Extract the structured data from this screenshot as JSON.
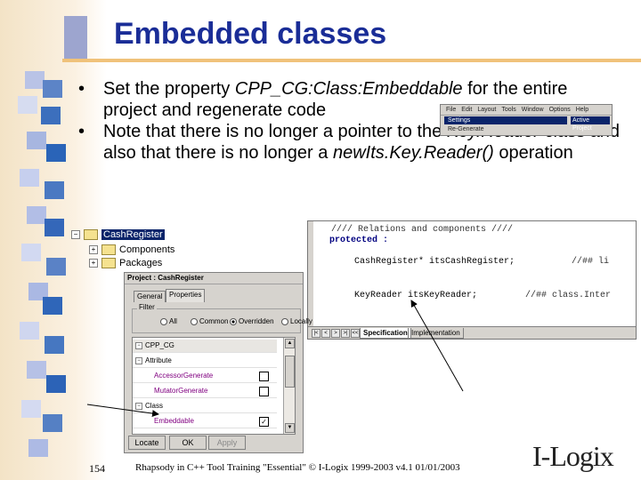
{
  "slide": {
    "title": "Embedded classes",
    "bullets": [
      {
        "marker": "•",
        "parts": [
          {
            "text": "Set the property ",
            "italic": false
          },
          {
            "text": "CPP_CG:Class:Embeddable",
            "italic": true
          },
          {
            "text": " for the entire project and regenerate code",
            "italic": false
          }
        ]
      },
      {
        "marker": "•",
        "parts": [
          {
            "text": "Note that there is no longer a pointer to the ",
            "italic": false
          },
          {
            "text": "Key.Reader",
            "italic": true
          },
          {
            "text": " class and also that there is no longer a ",
            "italic": false
          },
          {
            "text": "newIts.Key.Reader()",
            "italic": true
          },
          {
            "text": " operation",
            "italic": false
          }
        ]
      }
    ],
    "page_number": "154",
    "footer": "Rhapsody in C++ Tool Training \"Essential\"  © I-Logix 1999-2003   v4.1  01/01/2003",
    "logo": "I-Logix"
  },
  "menu_snippet": {
    "menu_items": [
      "File",
      "Edit",
      "Layout",
      "Tools",
      "Window",
      "Options",
      "Help"
    ],
    "rows": [
      "Settings",
      "Re-Generate"
    ],
    "submenu": "Active Project"
  },
  "tree": {
    "root": "CashRegister",
    "children": [
      "Components",
      "Packages"
    ]
  },
  "code_view": {
    "lines": [
      {
        "code": "////    Relations and components    ////",
        "kind": "comment"
      },
      {
        "code": "protected :",
        "kind": "keyword"
      },
      {
        "code": "CashRegister* itsCashRegister;",
        "kind": "code",
        "comment": "//## li"
      },
      {
        "code": "KeyReader itsKeyReader;",
        "kind": "code",
        "comment": "//## class.Inter"
      }
    ],
    "tabs": [
      "Specification",
      "Implementation"
    ],
    "active_tab": "Specification",
    "nav_buttons": [
      "|<",
      "<",
      ">",
      ">|",
      "<<",
      ">>"
    ]
  },
  "dialog": {
    "title": "Project : CashRegister",
    "tabs": [
      "General",
      "Properties"
    ],
    "active_tab": "Properties",
    "filter_label": "Filter",
    "filter_options": [
      "All",
      "Common",
      "Overridden",
      "Locally"
    ],
    "filter_selected": "Overridden",
    "grid_rows": [
      {
        "label": "CPP_CG",
        "type": "group",
        "expanded": true
      },
      {
        "label": "Attribute",
        "type": "group",
        "expanded": true
      },
      {
        "label": "AccessorGenerate",
        "type": "prop",
        "checked": false
      },
      {
        "label": "MutatorGenerate",
        "type": "prop",
        "checked": false
      },
      {
        "label": "Class",
        "type": "group",
        "expanded": true
      },
      {
        "label": "Embeddable",
        "type": "prop",
        "checked": true
      }
    ],
    "buttons": [
      "Locate",
      "OK",
      "Apply"
    ],
    "apply_disabled": true
  }
}
